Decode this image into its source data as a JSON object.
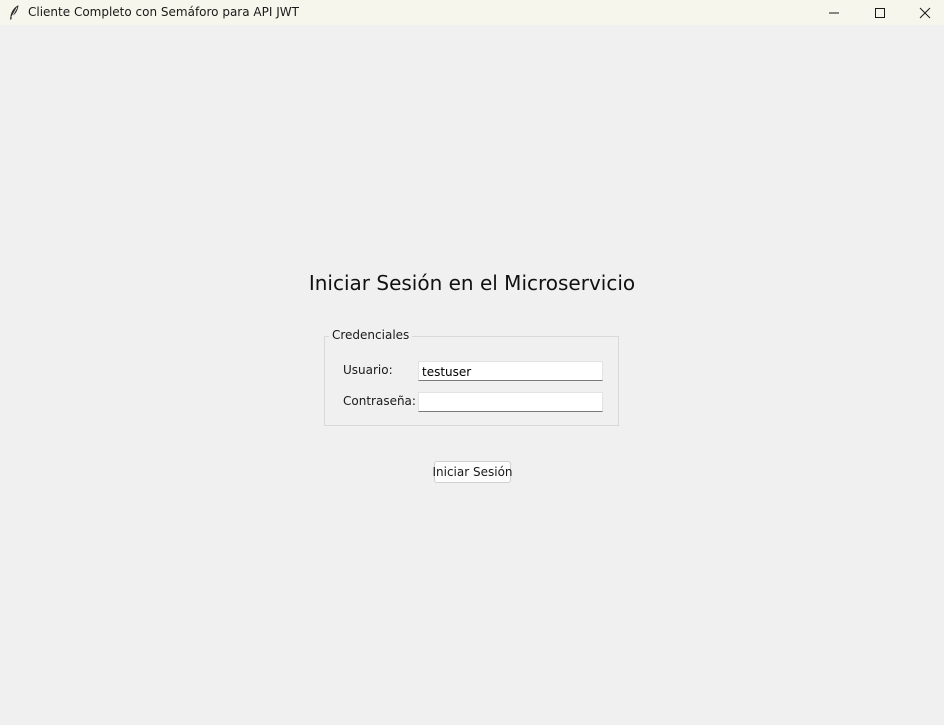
{
  "window": {
    "title": "Cliente Completo con Semáforo para API JWT",
    "icon": "feather-icon",
    "controls": [
      "minimize-icon",
      "maximize-icon",
      "close-icon"
    ]
  },
  "main": {
    "heading": "Iniciar Sesión en el Microservicio",
    "credentials": {
      "legend": "Credenciales",
      "username_label": "Usuario:",
      "username_value": "testuser",
      "password_label": "Contraseña:",
      "password_value": ""
    },
    "login_button_label": "Iniciar Sesión"
  }
}
